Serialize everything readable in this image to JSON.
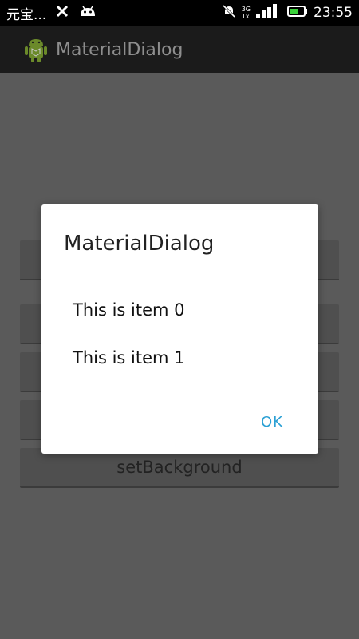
{
  "status_bar": {
    "carrier": "元宝...",
    "net_type": "3G",
    "net_sub": "1x",
    "time": "23:55",
    "icons": [
      "usb-debug-icon",
      "android-icon",
      "mute-icon",
      "signal-icon",
      "battery-icon"
    ]
  },
  "action_bar": {
    "title": "MaterialDialog",
    "icon": "android-robot-icon"
  },
  "background_buttons": {
    "last_label": "setBackground"
  },
  "dialog": {
    "title": "MaterialDialog",
    "items": [
      "This is item 0",
      "This is item 1"
    ],
    "ok_label": "OK"
  },
  "colors": {
    "accent": "#2ba0d4",
    "dim_overlay": "#5a5a5a",
    "action_bar": "#1b1b1b"
  }
}
